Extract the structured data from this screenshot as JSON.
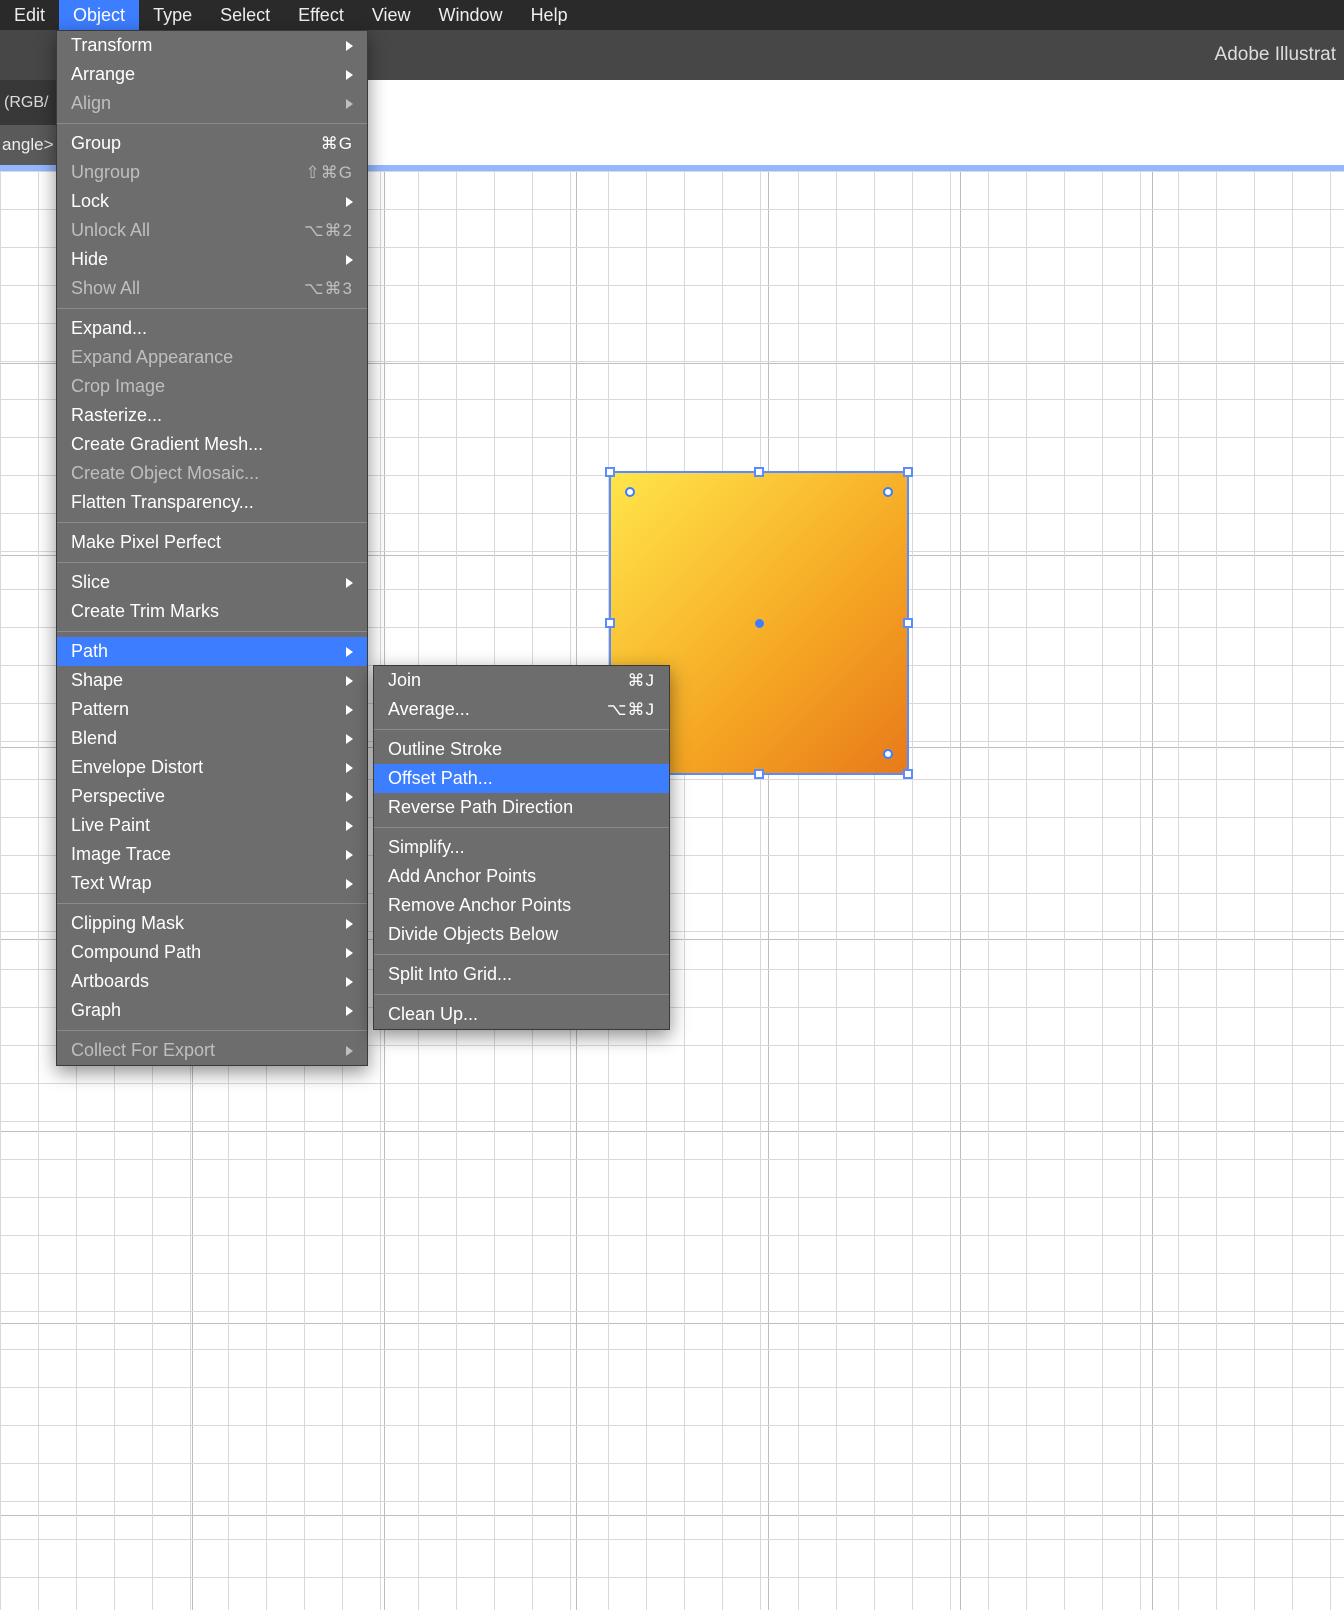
{
  "menubar": [
    "Edit",
    "Object",
    "Type",
    "Select",
    "Effect",
    "View",
    "Window",
    "Help"
  ],
  "menubar_active": 1,
  "titlebar": "Adobe Illustrat",
  "docbar": "(RGB/",
  "breadbar": "angle>",
  "object_menu": [
    {
      "t": "item",
      "label": "Transform",
      "arrow": true
    },
    {
      "t": "item",
      "label": "Arrange",
      "arrow": true
    },
    {
      "t": "item",
      "label": "Align",
      "arrow": true,
      "disabled": true
    },
    {
      "t": "sep"
    },
    {
      "t": "item",
      "label": "Group",
      "shortcut": "⌘G"
    },
    {
      "t": "item",
      "label": "Ungroup",
      "shortcut": "⇧⌘G",
      "disabled": true
    },
    {
      "t": "item",
      "label": "Lock",
      "arrow": true
    },
    {
      "t": "item",
      "label": "Unlock All",
      "shortcut": "⌥⌘2",
      "disabled": true
    },
    {
      "t": "item",
      "label": "Hide",
      "arrow": true
    },
    {
      "t": "item",
      "label": "Show All",
      "shortcut": "⌥⌘3",
      "disabled": true
    },
    {
      "t": "sep"
    },
    {
      "t": "item",
      "label": "Expand..."
    },
    {
      "t": "item",
      "label": "Expand Appearance",
      "disabled": true
    },
    {
      "t": "item",
      "label": "Crop Image",
      "disabled": true
    },
    {
      "t": "item",
      "label": "Rasterize..."
    },
    {
      "t": "item",
      "label": "Create Gradient Mesh..."
    },
    {
      "t": "item",
      "label": "Create Object Mosaic...",
      "disabled": true
    },
    {
      "t": "item",
      "label": "Flatten Transparency..."
    },
    {
      "t": "sep"
    },
    {
      "t": "item",
      "label": "Make Pixel Perfect"
    },
    {
      "t": "sep"
    },
    {
      "t": "item",
      "label": "Slice",
      "arrow": true
    },
    {
      "t": "item",
      "label": "Create Trim Marks"
    },
    {
      "t": "sep"
    },
    {
      "t": "item",
      "label": "Path",
      "arrow": true,
      "highlight": true
    },
    {
      "t": "item",
      "label": "Shape",
      "arrow": true
    },
    {
      "t": "item",
      "label": "Pattern",
      "arrow": true
    },
    {
      "t": "item",
      "label": "Blend",
      "arrow": true
    },
    {
      "t": "item",
      "label": "Envelope Distort",
      "arrow": true
    },
    {
      "t": "item",
      "label": "Perspective",
      "arrow": true
    },
    {
      "t": "item",
      "label": "Live Paint",
      "arrow": true
    },
    {
      "t": "item",
      "label": "Image Trace",
      "arrow": true
    },
    {
      "t": "item",
      "label": "Text Wrap",
      "arrow": true
    },
    {
      "t": "sep"
    },
    {
      "t": "item",
      "label": "Clipping Mask",
      "arrow": true
    },
    {
      "t": "item",
      "label": "Compound Path",
      "arrow": true
    },
    {
      "t": "item",
      "label": "Artboards",
      "arrow": true
    },
    {
      "t": "item",
      "label": "Graph",
      "arrow": true
    },
    {
      "t": "sep"
    },
    {
      "t": "item",
      "label": "Collect For Export",
      "arrow": true,
      "disabled": true
    }
  ],
  "path_menu": [
    {
      "t": "item",
      "label": "Join",
      "shortcut": "⌘J"
    },
    {
      "t": "item",
      "label": "Average...",
      "shortcut": "⌥⌘J"
    },
    {
      "t": "sep"
    },
    {
      "t": "item",
      "label": "Outline Stroke"
    },
    {
      "t": "item",
      "label": "Offset Path...",
      "highlight": true
    },
    {
      "t": "item",
      "label": "Reverse Path Direction"
    },
    {
      "t": "sep"
    },
    {
      "t": "item",
      "label": "Simplify..."
    },
    {
      "t": "item",
      "label": "Add Anchor Points"
    },
    {
      "t": "item",
      "label": "Remove Anchor Points"
    },
    {
      "t": "item",
      "label": "Divide Objects Below"
    },
    {
      "t": "sep"
    },
    {
      "t": "item",
      "label": "Split Into Grid..."
    },
    {
      "t": "sep"
    },
    {
      "t": "item",
      "label": "Clean Up..."
    }
  ]
}
